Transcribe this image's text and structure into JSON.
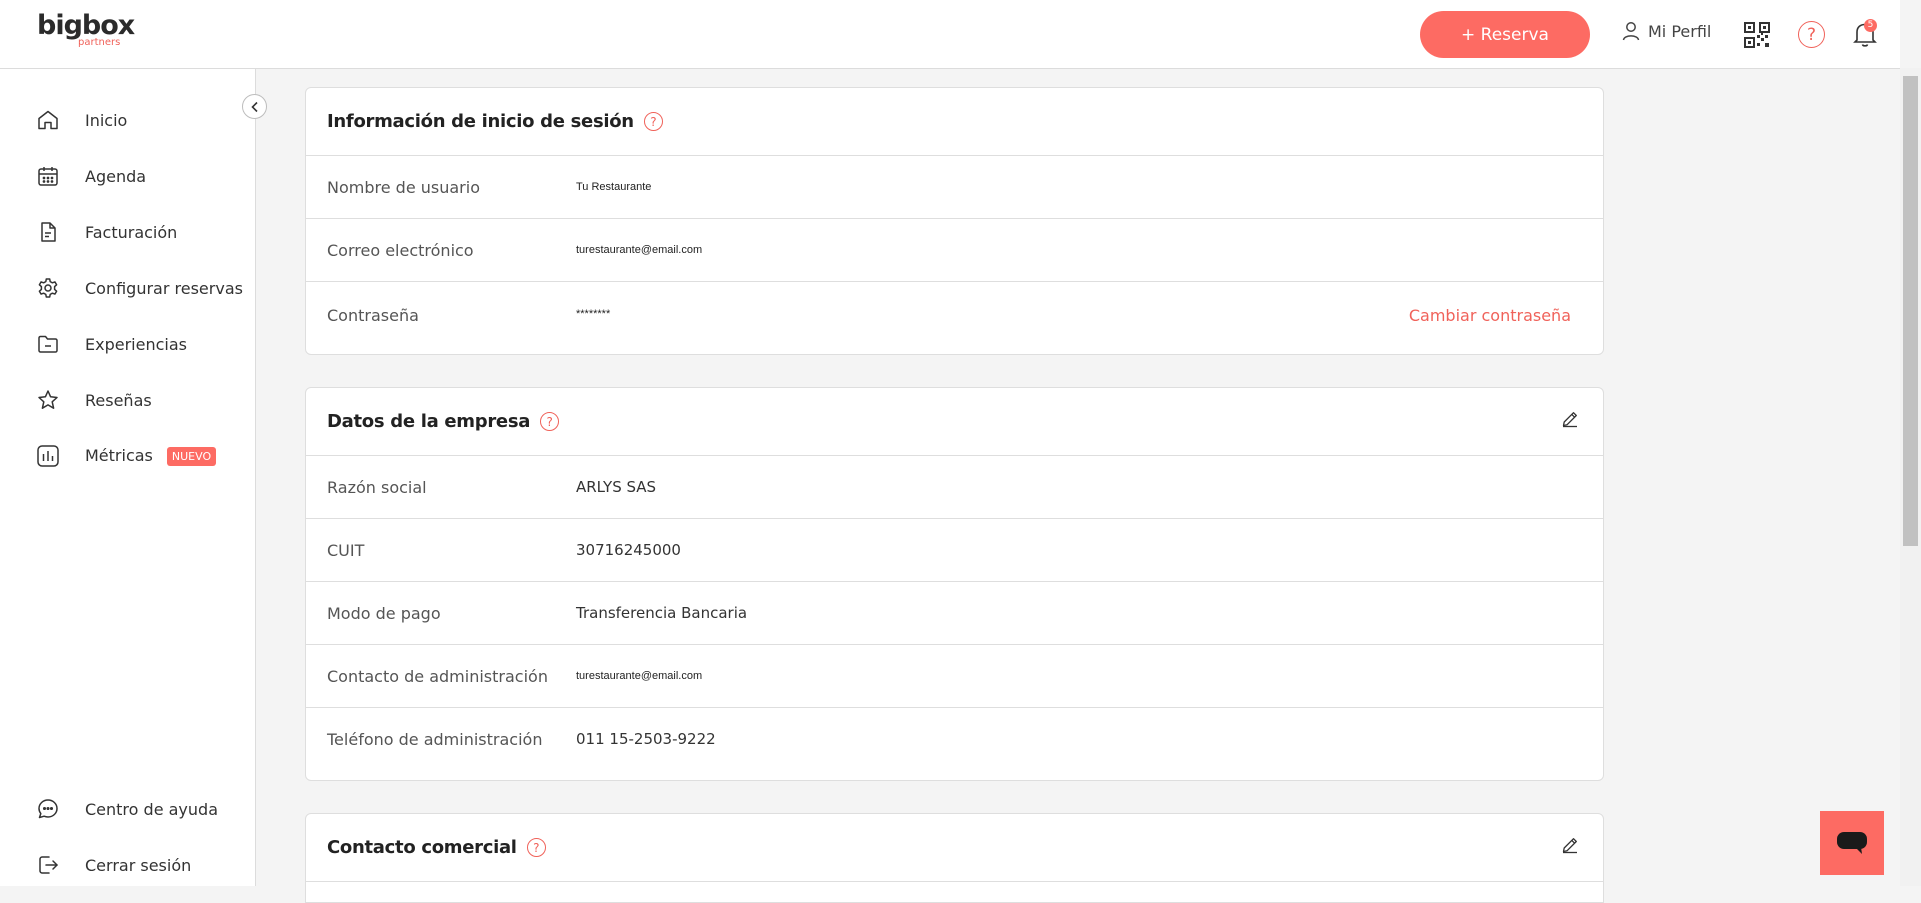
{
  "brand": {
    "name": "bigbox",
    "sub": "partners"
  },
  "topbar": {
    "reserva_label": "+ Reserva",
    "perfil_label": "Mi Perfil",
    "help_label": "?",
    "notification_count": "5"
  },
  "sidebar": {
    "items": [
      {
        "label": "Inicio",
        "icon": "home-icon"
      },
      {
        "label": "Agenda",
        "icon": "calendar-icon"
      },
      {
        "label": "Facturación",
        "icon": "document-icon"
      },
      {
        "label": "Configurar reservas",
        "icon": "gear-icon"
      },
      {
        "label": "Experiencias",
        "icon": "folder-icon"
      },
      {
        "label": "Reseñas",
        "icon": "star-icon"
      },
      {
        "label": "Métricas",
        "icon": "bar-chart-icon",
        "badge": "NUEVO"
      }
    ],
    "bottom_items": [
      {
        "label": "Centro de ayuda",
        "icon": "chat-bubble-icon"
      },
      {
        "label": "Cerrar sesión",
        "icon": "logout-icon"
      }
    ]
  },
  "login_card": {
    "title": "Información de inicio de sesión",
    "help": "?",
    "rows": [
      {
        "label": "Nombre de usuario",
        "value": "Tu Restaurante"
      },
      {
        "label": "Correo electrónico",
        "value": "turestaurante@email.com"
      },
      {
        "label": "Contraseña",
        "value": "********",
        "action": "Cambiar contraseña"
      }
    ]
  },
  "company_card": {
    "title": "Datos de la empresa",
    "help": "?",
    "rows": [
      {
        "label": "Razón social",
        "value": "ARLYS SAS"
      },
      {
        "label": "CUIT",
        "value": "30716245000"
      },
      {
        "label": "Modo de pago",
        "value": "Transferencia Bancaria"
      },
      {
        "label": "Contacto de administración",
        "value": "turestaurante@email.com"
      },
      {
        "label": "Teléfono de administración",
        "value": "011 15-2503-9222"
      }
    ]
  },
  "commercial_card": {
    "title": "Contacto comercial",
    "help": "?"
  },
  "colors": {
    "accent": "#fd6b63",
    "accent_text": "#f0625a"
  }
}
